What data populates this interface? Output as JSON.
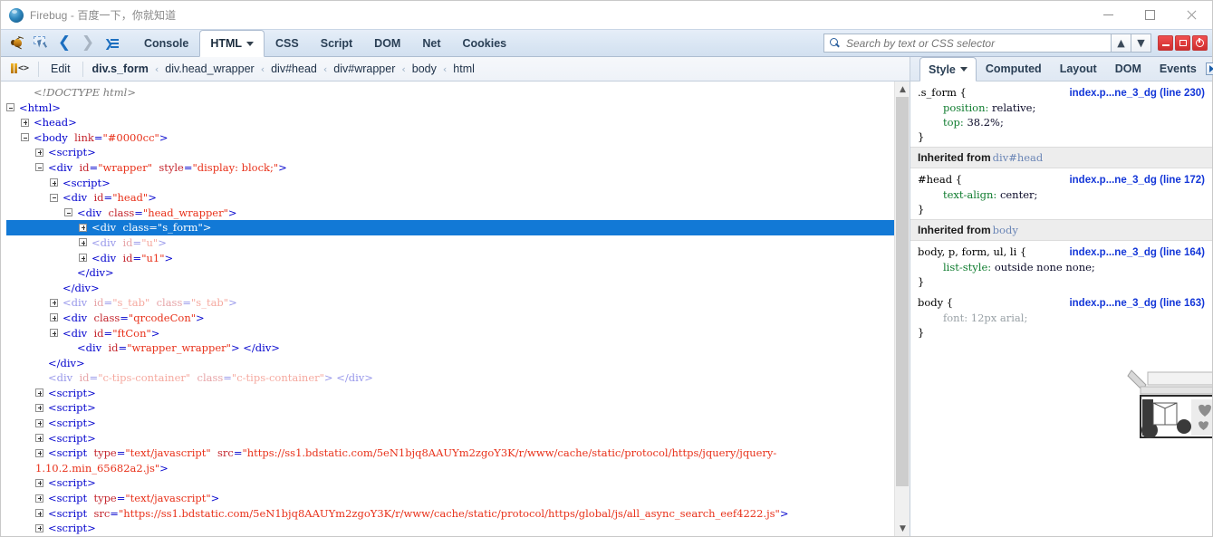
{
  "window": {
    "title": "Firebug - 百度一下，你就知道",
    "app_icon": "firebug-globe-icon",
    "controls": {
      "minimize": "minimize-icon",
      "maximize": "maximize-icon",
      "close": "close-icon"
    }
  },
  "toolbar": {
    "icons": [
      {
        "name": "firebug-bug-icon",
        "label": "Firebug"
      },
      {
        "name": "inspect-element-icon",
        "label": "Inspect Element"
      },
      {
        "name": "back-arrow-icon",
        "label": "Back"
      },
      {
        "name": "forward-arrow-icon",
        "label": "Forward"
      },
      {
        "name": "panel-list-icon",
        "label": "Panels"
      }
    ],
    "tabs": [
      {
        "label": "Console",
        "active": false,
        "has_caret": false
      },
      {
        "label": "HTML",
        "active": true,
        "has_caret": true
      },
      {
        "label": "CSS",
        "active": false,
        "has_caret": false
      },
      {
        "label": "Script",
        "active": false,
        "has_caret": false
      },
      {
        "label": "DOM",
        "active": false,
        "has_caret": false
      },
      {
        "label": "Net",
        "active": false,
        "has_caret": false
      },
      {
        "label": "Cookies",
        "active": false,
        "has_caret": false
      }
    ],
    "search": {
      "placeholder": "Search by text or CSS selector",
      "value": "",
      "icon": "search-icon",
      "prev": "▲",
      "next": "▼"
    },
    "window_buttons": [
      {
        "name": "firebug-minimize-button",
        "glyph": "minimize-icon"
      },
      {
        "name": "firebug-detach-button",
        "glyph": "detach-icon"
      },
      {
        "name": "firebug-close-button",
        "glyph": "power-icon"
      }
    ]
  },
  "panelbar": {
    "code_icon": "html-source-icon",
    "edit_label": "Edit",
    "separator": "‹",
    "breadcrumb": [
      {
        "label": "div.s_form",
        "current": true
      },
      {
        "label": "div.head_wrapper",
        "current": false
      },
      {
        "label": "div#head",
        "current": false
      },
      {
        "label": "div#wrapper",
        "current": false
      },
      {
        "label": "body",
        "current": false
      },
      {
        "label": "html",
        "current": false
      }
    ],
    "side_tabs": [
      {
        "label": "Style",
        "active": true,
        "has_caret": true
      },
      {
        "label": "Computed",
        "active": false,
        "has_caret": false
      },
      {
        "label": "Layout",
        "active": false,
        "has_caret": false
      },
      {
        "label": "DOM",
        "active": false,
        "has_caret": false
      },
      {
        "label": "Events",
        "active": false,
        "has_caret": false
      }
    ],
    "more_button": "more-panels-icon"
  },
  "html_tree": {
    "rows": [
      {
        "indent": 1,
        "twisty": "none",
        "kind": "doctype",
        "text": "<!DOCTYPE html>"
      },
      {
        "indent": 0,
        "twisty": "minus",
        "kind": "tag",
        "tag": "html",
        "attrs": []
      },
      {
        "indent": 1,
        "twisty": "plus",
        "kind": "tag",
        "tag": "head",
        "attrs": []
      },
      {
        "indent": 1,
        "twisty": "minus",
        "kind": "tag",
        "tag": "body",
        "attrs": [
          {
            "n": "link",
            "v": "#0000cc"
          }
        ]
      },
      {
        "indent": 2,
        "twisty": "plus",
        "kind": "tag",
        "tag": "script",
        "attrs": []
      },
      {
        "indent": 2,
        "twisty": "minus",
        "kind": "tag",
        "tag": "div",
        "attrs": [
          {
            "n": "id",
            "v": "wrapper"
          },
          {
            "n": "style",
            "v": "display: block;"
          }
        ]
      },
      {
        "indent": 3,
        "twisty": "plus",
        "kind": "tag",
        "tag": "script",
        "attrs": []
      },
      {
        "indent": 3,
        "twisty": "minus",
        "kind": "tag",
        "tag": "div",
        "attrs": [
          {
            "n": "id",
            "v": "head"
          }
        ]
      },
      {
        "indent": 4,
        "twisty": "minus",
        "kind": "tag",
        "tag": "div",
        "attrs": [
          {
            "n": "class",
            "v": "head_wrapper"
          }
        ]
      },
      {
        "indent": 5,
        "twisty": "plus",
        "kind": "tag",
        "tag": "div",
        "attrs": [
          {
            "n": "class",
            "v": "s_form"
          }
        ],
        "selected": true
      },
      {
        "indent": 5,
        "twisty": "plus",
        "kind": "tag",
        "tag": "div",
        "attrs": [
          {
            "n": "id",
            "v": "u"
          }
        ],
        "dim": true
      },
      {
        "indent": 5,
        "twisty": "plus",
        "kind": "tag",
        "tag": "div",
        "attrs": [
          {
            "n": "id",
            "v": "u1"
          }
        ]
      },
      {
        "indent": 4,
        "twisty": "none",
        "kind": "close",
        "tag": "div"
      },
      {
        "indent": 3,
        "twisty": "none",
        "kind": "close",
        "tag": "div"
      },
      {
        "indent": 3,
        "twisty": "plus",
        "kind": "tag",
        "tag": "div",
        "attrs": [
          {
            "n": "id",
            "v": "s_tab"
          },
          {
            "n": "class",
            "v": "s_tab"
          }
        ],
        "dim": true
      },
      {
        "indent": 3,
        "twisty": "plus",
        "kind": "tag",
        "tag": "div",
        "attrs": [
          {
            "n": "class",
            "v": "qrcodeCon"
          }
        ]
      },
      {
        "indent": 3,
        "twisty": "plus",
        "kind": "tag",
        "tag": "div",
        "attrs": [
          {
            "n": "id",
            "v": "ftCon"
          }
        ]
      },
      {
        "indent": 4,
        "twisty": "none",
        "kind": "pair",
        "tag": "div",
        "attrs": [
          {
            "n": "id",
            "v": "wrapper_wrapper"
          }
        ]
      },
      {
        "indent": 2,
        "twisty": "none",
        "kind": "close",
        "tag": "div"
      },
      {
        "indent": 2,
        "twisty": "none",
        "kind": "pair",
        "tag": "div",
        "attrs": [
          {
            "n": "id",
            "v": "c-tips-container"
          },
          {
            "n": "class",
            "v": "c-tips-container"
          }
        ],
        "dim": true
      },
      {
        "indent": 2,
        "twisty": "plus",
        "kind": "tag",
        "tag": "script",
        "attrs": []
      },
      {
        "indent": 2,
        "twisty": "plus",
        "kind": "tag",
        "tag": "script",
        "attrs": []
      },
      {
        "indent": 2,
        "twisty": "plus",
        "kind": "tag",
        "tag": "script",
        "attrs": []
      },
      {
        "indent": 2,
        "twisty": "plus",
        "kind": "tag",
        "tag": "script",
        "attrs": []
      },
      {
        "indent": 2,
        "twisty": "plus",
        "kind": "tag",
        "tag": "script",
        "attrs": [
          {
            "n": "type",
            "v": "text/javascript"
          },
          {
            "n": "src",
            "v": "https://ss1.bdstatic.com/5eN1bjq8AAUYm2zgoY3K/r/www/cache/static/protocol/https/jquery/jquery-1.10.2.min_65682a2.js"
          }
        ],
        "wrap": true
      },
      {
        "indent": 2,
        "twisty": "plus",
        "kind": "tag",
        "tag": "script",
        "attrs": []
      },
      {
        "indent": 2,
        "twisty": "plus",
        "kind": "tag",
        "tag": "script",
        "attrs": [
          {
            "n": "type",
            "v": "text/javascript"
          }
        ]
      },
      {
        "indent": 2,
        "twisty": "plus",
        "kind": "tag",
        "tag": "script",
        "attrs": [
          {
            "n": "src",
            "v": "https://ss1.bdstatic.com/5eN1bjq8AAUYm2zgoY3K/r/www/cache/static/protocol/https/global/js/all_async_search_eef4222.js"
          }
        ]
      },
      {
        "indent": 2,
        "twisty": "plus",
        "kind": "tag",
        "tag": "script",
        "attrs": []
      }
    ],
    "scrollbar": {
      "up": "▲",
      "down": "▼"
    }
  },
  "style_panel": {
    "blocks": [
      {
        "type": "rule",
        "selector": ".s_form {",
        "source": "index.p...ne_3_dg (line 230)",
        "props": [
          {
            "name": "position:",
            "value": "relative;"
          },
          {
            "name": "top:",
            "value": "38.2%;"
          }
        ],
        "faded": false
      },
      {
        "type": "inherit",
        "label": "Inherited from",
        "target": "div#head"
      },
      {
        "type": "rule",
        "selector": "#head {",
        "source": "index.p...ne_3_dg (line 172)",
        "props": [
          {
            "name": "text-align:",
            "value": "center;"
          }
        ],
        "faded": false
      },
      {
        "type": "inherit",
        "label": "Inherited from",
        "target": "body"
      },
      {
        "type": "rule",
        "selector": "body, p, form, ul, li {",
        "source": "index.p...ne_3_dg (line 164)",
        "props": [
          {
            "name": "list-style:",
            "value": "outside none none;"
          }
        ],
        "faded": false
      },
      {
        "type": "rule",
        "selector": "body {",
        "source": "index.p...ne_3_dg (line 163)",
        "props": [
          {
            "name": "font:",
            "value": "12px arial;"
          }
        ],
        "faded": true
      }
    ],
    "close_brace": "}"
  },
  "colors": {
    "selection_blue": "#1279d6",
    "tag_blue": "#0000cd",
    "attr_red": "#c4262e",
    "value_red": "#e8311a",
    "prop_green": "#0f7c2f",
    "link_blue": "#1336d8",
    "toolbar_bg": "#dbe7f4"
  }
}
